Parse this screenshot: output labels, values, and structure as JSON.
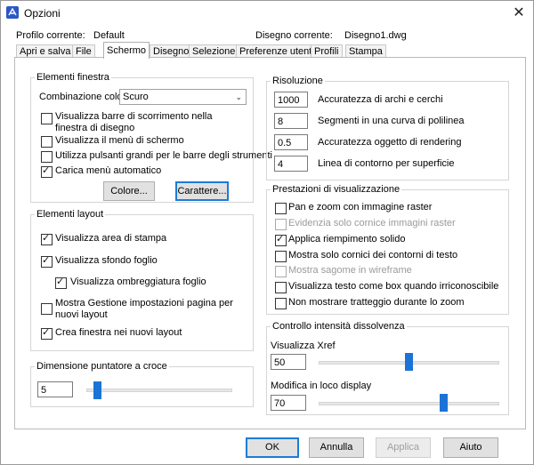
{
  "window": {
    "title": "Opzioni",
    "close_symbol": "✕"
  },
  "header": {
    "profile_label": "Profilo corrente:",
    "profile_value": "Default",
    "drawing_label": "Disegno corrente:",
    "drawing_value": "Disegno1.dwg"
  },
  "tabs": [
    "Apri e salva",
    "File",
    "Schermo",
    "Disegno",
    "Selezione",
    "Preferenze utente",
    "Profili",
    "Stampa"
  ],
  "active_tab": "Schermo",
  "window_elements": {
    "legend": "Elementi finestra",
    "color_scheme_label": "Combinazione colori",
    "color_scheme_value": "Scuro",
    "options": [
      {
        "label": "Visualizza barre di scorrimento nella finestra di disegno",
        "checked": false
      },
      {
        "label": "Visualizza il menù di schermo",
        "checked": false
      },
      {
        "label": "Utilizza pulsanti grandi per le barre degli strumenti",
        "checked": false
      },
      {
        "label": "Carica menù automatico",
        "checked": true
      }
    ],
    "colors_button": "Colore...",
    "fonts_button": "Carattere..."
  },
  "layout_elements": {
    "legend": "Elementi layout",
    "options": [
      {
        "label": "Visualizza area di stampa",
        "checked": true
      },
      {
        "label": "Visualizza sfondo foglio",
        "checked": true
      },
      {
        "label": "Visualizza ombreggiatura foglio",
        "checked": true
      },
      {
        "label": "Mostra Gestione impostazioni pagina per nuovi layout",
        "checked": false
      },
      {
        "label": "Crea finestra nei nuovi layout",
        "checked": true
      }
    ]
  },
  "crosshair": {
    "legend": "Dimensione puntatore a croce",
    "value": "5",
    "slider_fraction": 0.05
  },
  "resolution": {
    "legend": "Risoluzione",
    "items": [
      {
        "value": "1000",
        "label": "Accuratezza di archi e cerchi"
      },
      {
        "value": "8",
        "label": "Segmenti in una curva di polilinea"
      },
      {
        "value": "0.5",
        "label": "Accuratezza oggetto di rendering"
      },
      {
        "value": "4",
        "label": "Linea di contorno per superficie"
      }
    ]
  },
  "performance": {
    "legend": "Prestazioni di visualizzazione",
    "options": [
      {
        "label": "Pan e zoom con immagine raster",
        "checked": false,
        "disabled": false
      },
      {
        "label": "Evidenzia solo cornice immagini raster",
        "checked": false,
        "disabled": true
      },
      {
        "label": "Applica riempimento solido",
        "checked": true,
        "disabled": false
      },
      {
        "label": "Mostra solo cornici dei contorni di testo",
        "checked": false,
        "disabled": false
      },
      {
        "label": "Mostra sagome in wireframe",
        "checked": false,
        "disabled": true
      },
      {
        "label": "Visualizza testo come box quando irriconoscibile",
        "checked": false,
        "disabled": false
      },
      {
        "label": "Non mostrare tratteggio durante lo zoom",
        "checked": false,
        "disabled": false
      }
    ]
  },
  "fade": {
    "legend": "Controllo intensità dissolvenza",
    "xref_label": "Visualizza Xref",
    "xref_value": "50",
    "xref_fraction": 0.5,
    "inplace_label": "Modifica in loco display",
    "inplace_value": "70",
    "inplace_fraction": 0.7
  },
  "footer": {
    "ok": "OK",
    "cancel": "Annulla",
    "apply": "Applica",
    "help": "Aiuto"
  },
  "colors": {
    "accent": "#1c73d6",
    "focus_border": "#1c7cd5"
  }
}
